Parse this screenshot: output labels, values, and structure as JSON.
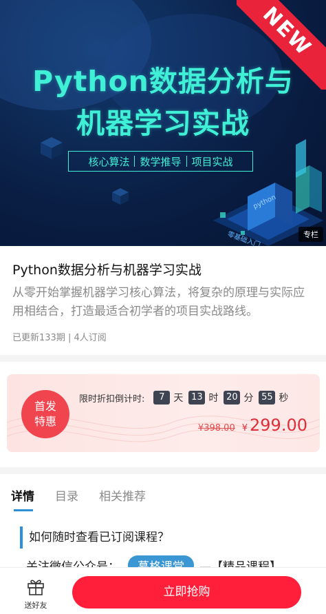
{
  "banner": {
    "title_line1": "Python数据分析与",
    "title_line2": "机器学习实战",
    "tags": [
      "核心算法",
      "数学推导",
      "项目实战"
    ],
    "ribbon": "NEW",
    "badge": "专栏",
    "iso_labels": [
      "python",
      "零基础入门"
    ]
  },
  "course": {
    "title": "Python数据分析与机器学习实战",
    "description": "从零开始掌握机器学习核心算法，将复杂的原理与实际应用相结合，打造最适合初学者的项目实战路线。",
    "meta": "已更新133期 | 4人订阅"
  },
  "promo": {
    "badge_line1": "首发",
    "badge_line2": "特惠",
    "countdown_label": "限时折扣倒计时:",
    "days": "7",
    "days_unit": "天",
    "hours": "13",
    "hours_unit": "时",
    "minutes": "20",
    "minutes_unit": "分",
    "seconds": "55",
    "seconds_unit": "秒",
    "old_price": "¥398.00",
    "new_price_symbol": "¥",
    "new_price": "299.00"
  },
  "tabs": [
    {
      "label": "详情",
      "active": true
    },
    {
      "label": "目录",
      "active": false
    },
    {
      "label": "相关推荐",
      "active": false
    }
  ],
  "details": {
    "section_title": "如何随时查看已订阅课程？",
    "line_prefix": "关注微信公众号：",
    "pill_text": "慕格课堂",
    "line_suffix": "—【精品课程】"
  },
  "bottom_bar": {
    "gift_label": "送好友",
    "buy_label": "立即抢购"
  },
  "colors": {
    "accent_blue": "#2d8fd6",
    "cta_red": "#ff1f3a",
    "banner_teal": "#3ff0d6",
    "price_red": "#e02d3a"
  }
}
